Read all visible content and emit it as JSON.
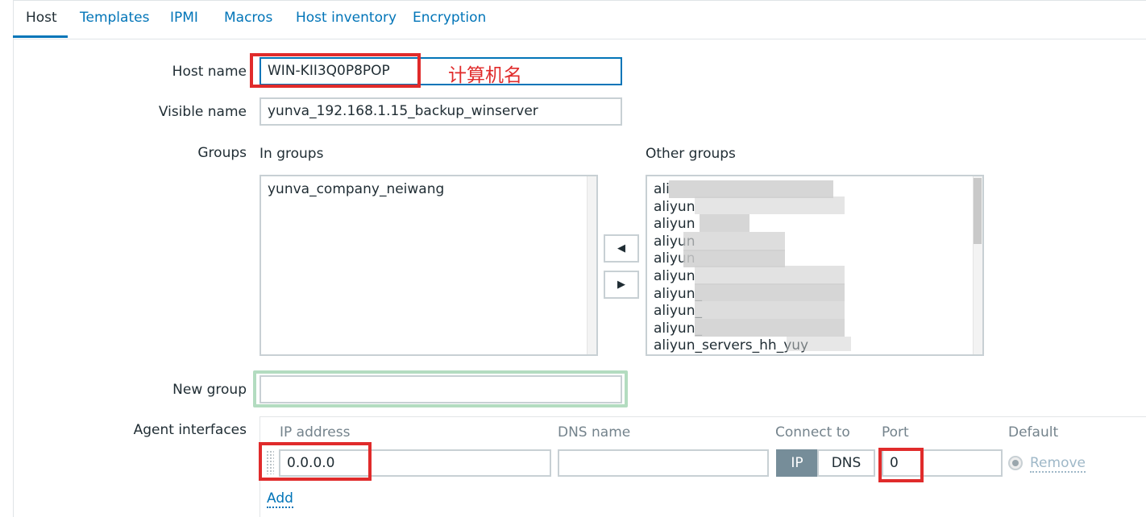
{
  "tabs": [
    {
      "label": "Host",
      "active": true
    },
    {
      "label": "Templates"
    },
    {
      "label": "IPMI"
    },
    {
      "label": "Macros"
    },
    {
      "label": "Host inventory"
    },
    {
      "label": "Encryption"
    }
  ],
  "form": {
    "host_name": {
      "label": "Host name",
      "value": "WIN-KII3Q0P8POP",
      "annotation": "计算机名"
    },
    "visible_name": {
      "label": "Visible name",
      "value": "yunva_192.168.1.15_backup_winserver"
    },
    "groups": {
      "label": "Groups",
      "in_groups_label": "In groups",
      "other_groups_label": "Other groups",
      "in_groups": [
        "yunva_company_neiwang"
      ],
      "other_groups": [
        "ali",
        "aliyun",
        "aliyun",
        "aliyun",
        "aliyun",
        "aliyun",
        "aliyun_",
        "aliyun_",
        "aliyun_",
        "aliyun_servers_hh_yuy"
      ],
      "move_left_icon": "arrow-left-icon",
      "move_right_icon": "arrow-right-icon"
    },
    "new_group": {
      "label": "New group",
      "value": ""
    },
    "agent_interfaces": {
      "label": "Agent interfaces",
      "columns": {
        "ip": "IP address",
        "dns": "DNS name",
        "connect": "Connect to",
        "port": "Port",
        "default": "Default"
      },
      "row": {
        "ip": "0.0.0.0",
        "dns": "",
        "connect_ip": "IP",
        "connect_dns": "DNS",
        "connect_selected": "IP",
        "port": "0",
        "remove": "Remove"
      },
      "add": "Add"
    }
  },
  "colors": {
    "link": "#0275b8",
    "highlight": "#e02b2b",
    "focus_border": "#0275b8",
    "new_group_border": "#b3dcc0"
  }
}
